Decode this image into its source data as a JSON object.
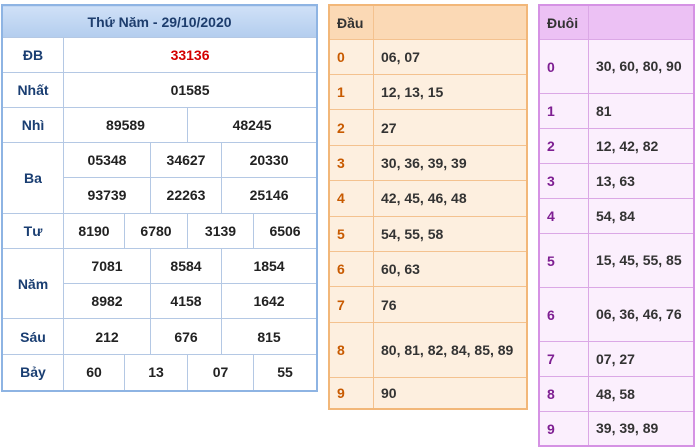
{
  "result": {
    "title": "Thứ Năm - 29/10/2020",
    "rows": {
      "db": {
        "label": "ĐB",
        "values": [
          "33136"
        ]
      },
      "nhat": {
        "label": "Nhất",
        "values": [
          "01585"
        ]
      },
      "nhi": {
        "label": "Nhì",
        "values": [
          "89589",
          "48245"
        ]
      },
      "ba": {
        "label": "Ba",
        "values": [
          "05348",
          "34627",
          "20330",
          "93739",
          "22263",
          "25146"
        ]
      },
      "tu": {
        "label": "Tư",
        "values": [
          "8190",
          "6780",
          "3139",
          "6506"
        ]
      },
      "nam": {
        "label": "Năm",
        "values": [
          "7081",
          "8584",
          "1854",
          "8982",
          "4158",
          "1642"
        ]
      },
      "sau": {
        "label": "Sáu",
        "values": [
          "212",
          "676",
          "815"
        ]
      },
      "bay": {
        "label": "Bảy",
        "values": [
          "60",
          "13",
          "07",
          "55"
        ]
      }
    }
  },
  "dau": {
    "header": "Đầu",
    "rows": [
      {
        "num": "0",
        "vals": "06, 07"
      },
      {
        "num": "1",
        "vals": "12, 13, 15"
      },
      {
        "num": "2",
        "vals": "27"
      },
      {
        "num": "3",
        "vals": "30, 36, 39, 39"
      },
      {
        "num": "4",
        "vals": "42, 45, 46, 48"
      },
      {
        "num": "5",
        "vals": "54, 55, 58"
      },
      {
        "num": "6",
        "vals": "60, 63"
      },
      {
        "num": "7",
        "vals": "76"
      },
      {
        "num": "8",
        "vals": "80, 81, 82, 84, 85, 89"
      },
      {
        "num": "9",
        "vals": "90"
      }
    ]
  },
  "duoi": {
    "header": "Đuôi",
    "rows": [
      {
        "num": "0",
        "vals": "30, 60, 80, 90"
      },
      {
        "num": "1",
        "vals": "81"
      },
      {
        "num": "2",
        "vals": "12, 42, 82"
      },
      {
        "num": "3",
        "vals": "13, 63"
      },
      {
        "num": "4",
        "vals": "54, 84"
      },
      {
        "num": "5",
        "vals": "15, 45, 55, 85"
      },
      {
        "num": "6",
        "vals": "06, 36, 46, 76"
      },
      {
        "num": "7",
        "vals": "07, 27"
      },
      {
        "num": "8",
        "vals": "48, 58"
      },
      {
        "num": "9",
        "vals": "39, 39, 89"
      }
    ]
  }
}
